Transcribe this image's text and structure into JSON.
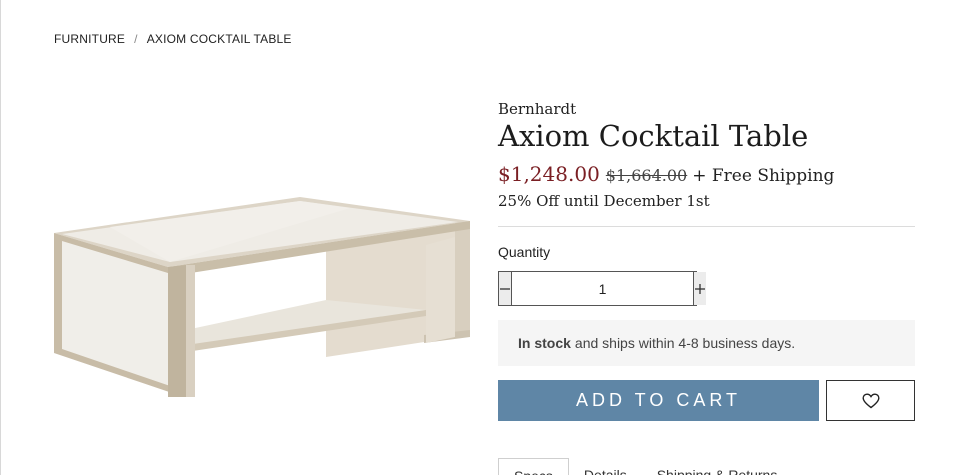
{
  "breadcrumb": {
    "items": [
      "FURNITURE",
      "AXIOM COCKTAIL TABLE"
    ],
    "separator": "/"
  },
  "product": {
    "brand": "Bernhardt",
    "title": "Axiom Cocktail Table",
    "price": "$1,248.00",
    "original_price": "$1,664.00",
    "shipping": "+ Free Shipping",
    "promo": "25% Off until December 1st",
    "image_alt": "Axiom Cocktail Table product photo"
  },
  "quantity": {
    "label": "Quantity",
    "value": "1",
    "minus_icon": "minus-icon",
    "plus_icon": "plus-icon"
  },
  "stock": {
    "status": "In stock",
    "detail": "and ships within 4-8 business days."
  },
  "actions": {
    "add_to_cart": "ADD TO CART",
    "wishlist_icon": "heart-icon"
  },
  "tabs": [
    "Specs",
    "Details",
    "Shipping & Returns"
  ],
  "colors": {
    "accent": "#5f86a6",
    "sale_price": "#7a1f24"
  }
}
